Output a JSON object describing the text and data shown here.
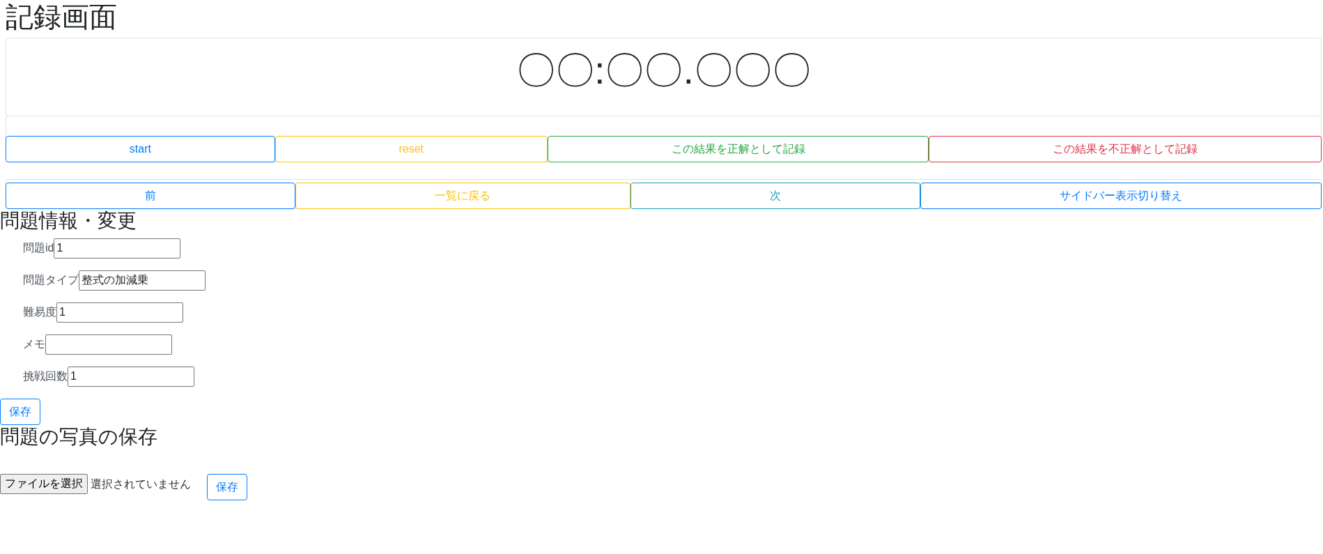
{
  "page_title": "記録画面",
  "timer": {
    "display": "〇〇:〇〇.〇〇〇"
  },
  "control_buttons": [
    {
      "label": "start",
      "color": "#007bff"
    },
    {
      "label": "reset",
      "color": "#ffc107"
    },
    {
      "label": "この結果を正解として記録",
      "color": "#28a745"
    },
    {
      "label": "この結果を不正解として記録",
      "color": "#dc3545"
    }
  ],
  "navigation_buttons": [
    {
      "label": "前",
      "color": "#007bff"
    },
    {
      "label": "一覧に戻る",
      "color": "#ffc107"
    },
    {
      "label": "次",
      "color": "#17a2b8"
    },
    {
      "label": "サイドバー表示切り替え",
      "color": "#007bff"
    }
  ],
  "problem_info": {
    "heading": "問題情報・変更",
    "fields": [
      {
        "label": "問題id",
        "value": "1"
      },
      {
        "label": "問題タイプ",
        "value": "整式の加減乗"
      },
      {
        "label": "難易度",
        "value": "1"
      },
      {
        "label": "メモ"
      },
      {
        "label": "挑戦回数",
        "value": "1"
      }
    ],
    "save_button": "保存"
  },
  "photo_upload": {
    "heading": "問題の写真の保存",
    "file_button": "ファイルを選択",
    "file_status": "選択されていません",
    "save_button": "保存"
  }
}
